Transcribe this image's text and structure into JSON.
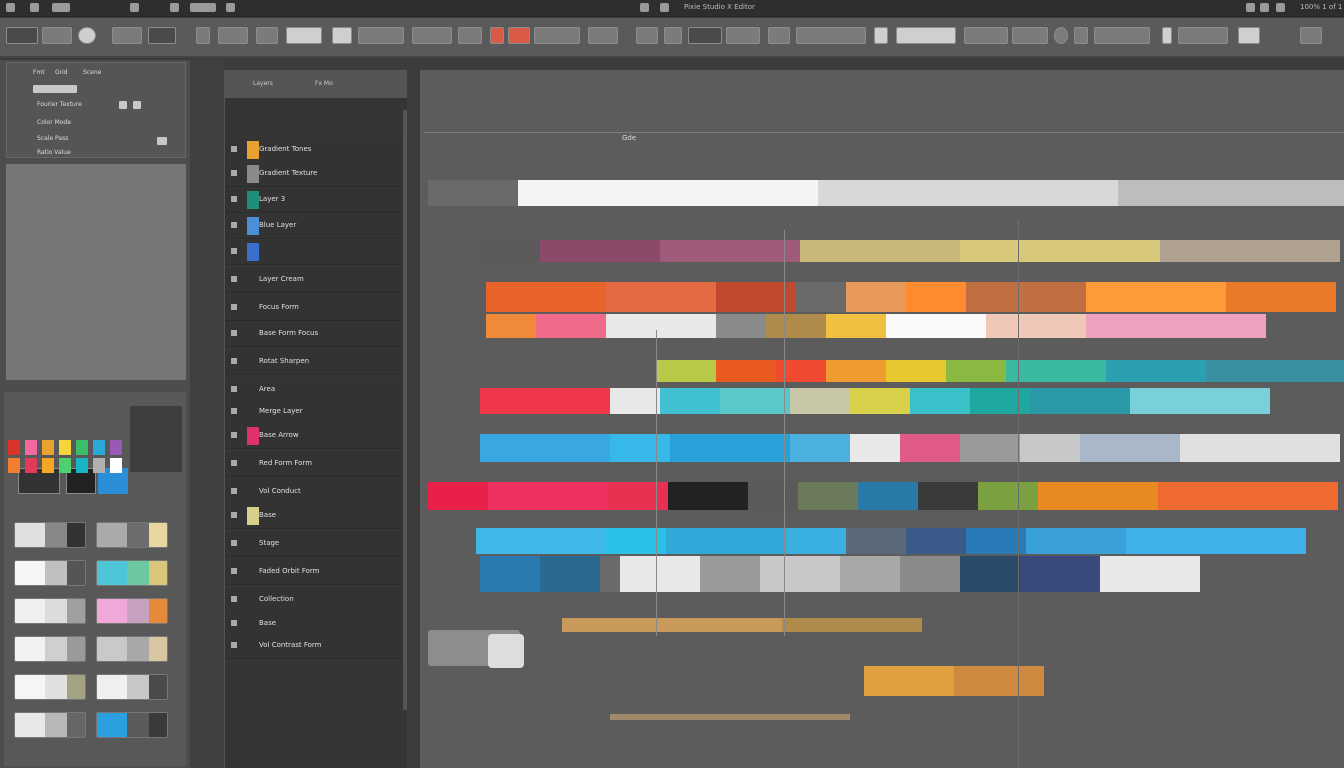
{
  "titlebar": {
    "title": "Pixie Studio X Editor",
    "right_label": "100% 1 of 1"
  },
  "canvas": {
    "label": "Gde"
  },
  "layers": {
    "header": [
      "Layers",
      "Fx Mo"
    ],
    "items": [
      {
        "name": "Gradient Tones",
        "color": "#e8a030"
      },
      {
        "name": "Gradient Texture",
        "color": "#8a8a8a"
      },
      {
        "name": "Layer 3",
        "color": "#1e8f7a"
      },
      {
        "name": "Blue Layer",
        "color": "#4a8fd8"
      },
      {
        "name": "",
        "color": "#3a6fd0"
      },
      {
        "name": "Layer Cream",
        "color": ""
      },
      {
        "name": "Focus Form",
        "color": ""
      },
      {
        "name": "Base Form Focus",
        "color": ""
      },
      {
        "name": "Rotat Sharpen",
        "color": ""
      },
      {
        "name": "Area",
        "color": ""
      },
      {
        "name": "Merge Layer",
        "color": ""
      },
      {
        "name": "Base Arrow",
        "color": "#e0326a"
      },
      {
        "name": "Red Form Form",
        "color": ""
      },
      {
        "name": "Vol Conduct",
        "color": ""
      },
      {
        "name": "Base",
        "color": "#d8d08a"
      },
      {
        "name": "Stage",
        "color": ""
      },
      {
        "name": "Faded Orbit Form",
        "color": ""
      },
      {
        "name": "Collection",
        "color": ""
      },
      {
        "name": "Base",
        "color": ""
      },
      {
        "name": "Vol Contrast Form",
        "color": ""
      }
    ]
  },
  "props": {
    "tabs": [
      "Fmt",
      "Grid",
      "Scene"
    ],
    "rows": [
      "Fourier Texture",
      "Color Mode",
      "Scale Pass",
      "Ratio Value"
    ]
  },
  "swatches": [
    "#d9342b",
    "#f06aa0",
    "#e8a330",
    "#f5d43c",
    "#3bbd6a",
    "#2aa8d8",
    "#9b59b6",
    "#f07e2e",
    "#e03b5a",
    "#f5a623",
    "#4cd16e",
    "#19b4c4",
    "#b0b0b0",
    "#ffffff"
  ],
  "thumbs": [
    {
      "colors": [
        "#e0e0e0",
        "#888",
        "#333"
      ]
    },
    {
      "colors": [
        "#aaa",
        "#6c6c6c",
        "#e8d7a0"
      ]
    },
    {
      "colors": [
        "#f5f5f5",
        "#c0c0c0",
        "#555"
      ]
    },
    {
      "colors": [
        "#4fc6d8",
        "#6cc8a0",
        "#d9c67a"
      ]
    },
    {
      "colors": [
        "#f0f0f0",
        "#dcdcdc",
        "#a0a0a0"
      ]
    },
    {
      "colors": [
        "#f0a8d8",
        "#c8a0c0",
        "#e48a3a"
      ]
    },
    {
      "colors": [
        "#f2f2f2",
        "#cfcfcf",
        "#9a9a9a"
      ]
    },
    {
      "colors": [
        "#c9c9c9",
        "#a8a8a8",
        "#d8c6a0"
      ]
    },
    {
      "colors": [
        "#f5f5f5",
        "#e0e0e0",
        "#a3a384"
      ]
    },
    {
      "colors": [
        "#f0f0f0",
        "#c8c8c8",
        "#4a4a4a"
      ]
    },
    {
      "colors": [
        "#e8e8e8",
        "#b8b8b8",
        "#666"
      ]
    },
    {
      "colors": [
        "#2aa0e0",
        "#5a5a5a",
        "#3a3a3a"
      ]
    }
  ],
  "colors": {
    "accent": "#e8a030",
    "app_bg": "#3c3c3c",
    "panel_dark": "#353535",
    "canvas_bg": "#5c5c5c"
  }
}
